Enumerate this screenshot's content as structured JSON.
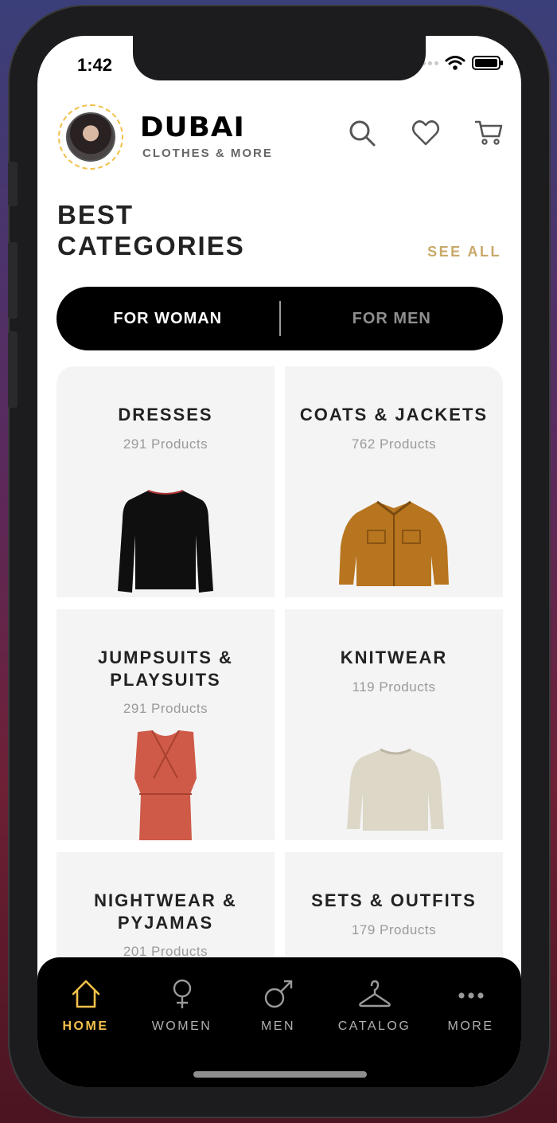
{
  "status": {
    "time": "1:42"
  },
  "brand": {
    "name": "DUBAI",
    "tagline": "CLOTHES & MORE"
  },
  "section": {
    "title_line1": "BEST",
    "title_line2": "CATEGORIES",
    "see_all": "SEE ALL"
  },
  "toggle": {
    "options": [
      "FOR WOMAN",
      "FOR MEN"
    ],
    "active": "FOR WOMAN"
  },
  "categories": [
    {
      "title": "DRESSES",
      "count": "291 Products"
    },
    {
      "title": "COATS & JACKETS",
      "count": "762 Products"
    },
    {
      "title": "JUMPSUITS & PLAYSUITS",
      "count": "291 Products"
    },
    {
      "title": "KNITWEAR",
      "count": "119 Products"
    },
    {
      "title": "NIGHTWEAR & PYJAMAS",
      "count": "201 Products"
    },
    {
      "title": "SETS & OUTFITS",
      "count": "179 Products"
    }
  ],
  "tabs": [
    {
      "label": "HOME",
      "icon": "home-icon",
      "active": true
    },
    {
      "label": "WOMEN",
      "icon": "female-icon",
      "active": false
    },
    {
      "label": "MEN",
      "icon": "male-icon",
      "active": false
    },
    {
      "label": "CATALOG",
      "icon": "hanger-icon",
      "active": false
    },
    {
      "label": "MORE",
      "icon": "more-icon",
      "active": false
    }
  ],
  "colors": {
    "accent": "#f3c04a",
    "see_all": "#c9a96a",
    "tabbar": "#000000",
    "card_bg": "#f4f4f4"
  }
}
